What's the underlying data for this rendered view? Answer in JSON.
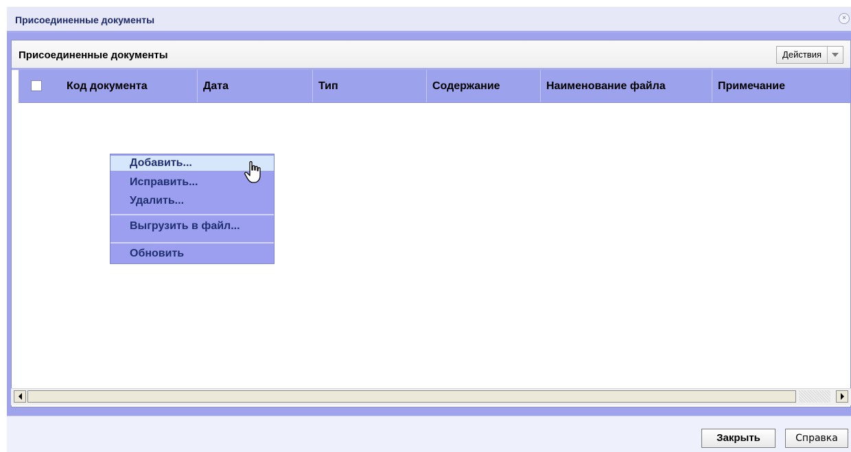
{
  "window": {
    "title": "Присоединенные документы",
    "close_icon": "close-icon"
  },
  "panel": {
    "title": "Присоединенные документы",
    "actions_label": "Действия",
    "actions_icon": "chevron-down-icon"
  },
  "grid": {
    "columns": [
      "Код документа",
      "Дата",
      "Тип",
      "Содержание",
      "Наименование файла",
      "Примечание"
    ]
  },
  "context_menu": {
    "items": [
      "Добавить...",
      "Исправить...",
      "Удалить...",
      "Выгрузить в файл...",
      "Обновить"
    ],
    "hovered": "Добавить..."
  },
  "footer": {
    "close_label": "Закрыть",
    "help_label": "Справка"
  },
  "colors": {
    "title_text": "#1b2a6b",
    "header_band": "#9da2ec",
    "menu_bg": "#9c9ff0",
    "menu_hover": "#d7e7fb"
  }
}
